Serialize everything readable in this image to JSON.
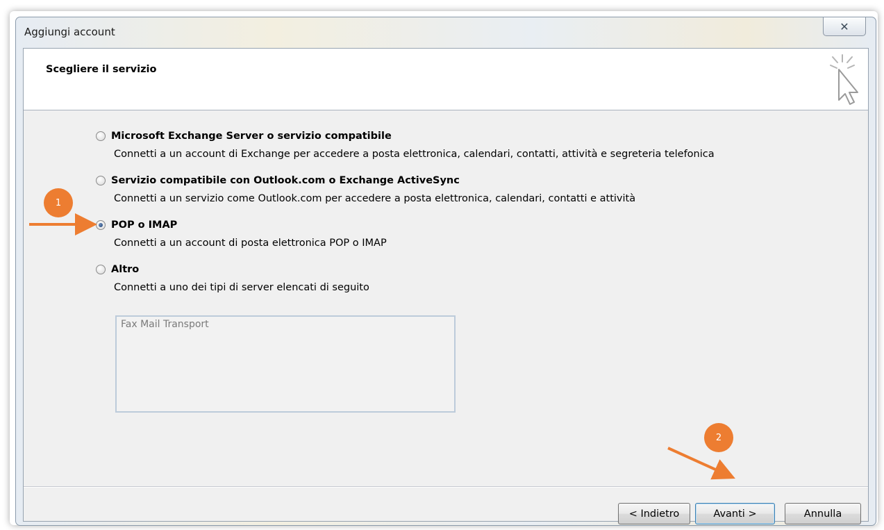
{
  "window": {
    "title": "Aggiungi account",
    "close_glyph": "✕",
    "close_icon": "close-icon"
  },
  "header": {
    "title": "Scegliere il servizio",
    "icon": "cursor-sparkle-icon"
  },
  "options": [
    {
      "label": "Microsoft Exchange Server o servizio compatibile",
      "description": "Connetti a un account di Exchange per accedere a posta elettronica, calendari, contatti, attività e segreteria telefonica",
      "selected": false
    },
    {
      "label": "Servizio compatibile con Outlook.com o Exchange ActiveSync",
      "description": "Connetti a un servizio come Outlook.com per accedere a posta elettronica, calendari, contatti e attività",
      "selected": false
    },
    {
      "label": "POP o IMAP",
      "description": "Connetti a un account di posta elettronica POP o IMAP",
      "selected": true
    },
    {
      "label": "Altro",
      "description": "Connetti a uno dei tipi di server elencati di seguito",
      "selected": false
    }
  ],
  "server_list": {
    "items": [
      "Fax Mail Transport"
    ]
  },
  "buttons": {
    "back": "< Indietro",
    "next": "Avanti >",
    "cancel": "Annulla"
  },
  "callouts": {
    "step1": "1",
    "step2": "2",
    "color": "#ed7d31"
  }
}
